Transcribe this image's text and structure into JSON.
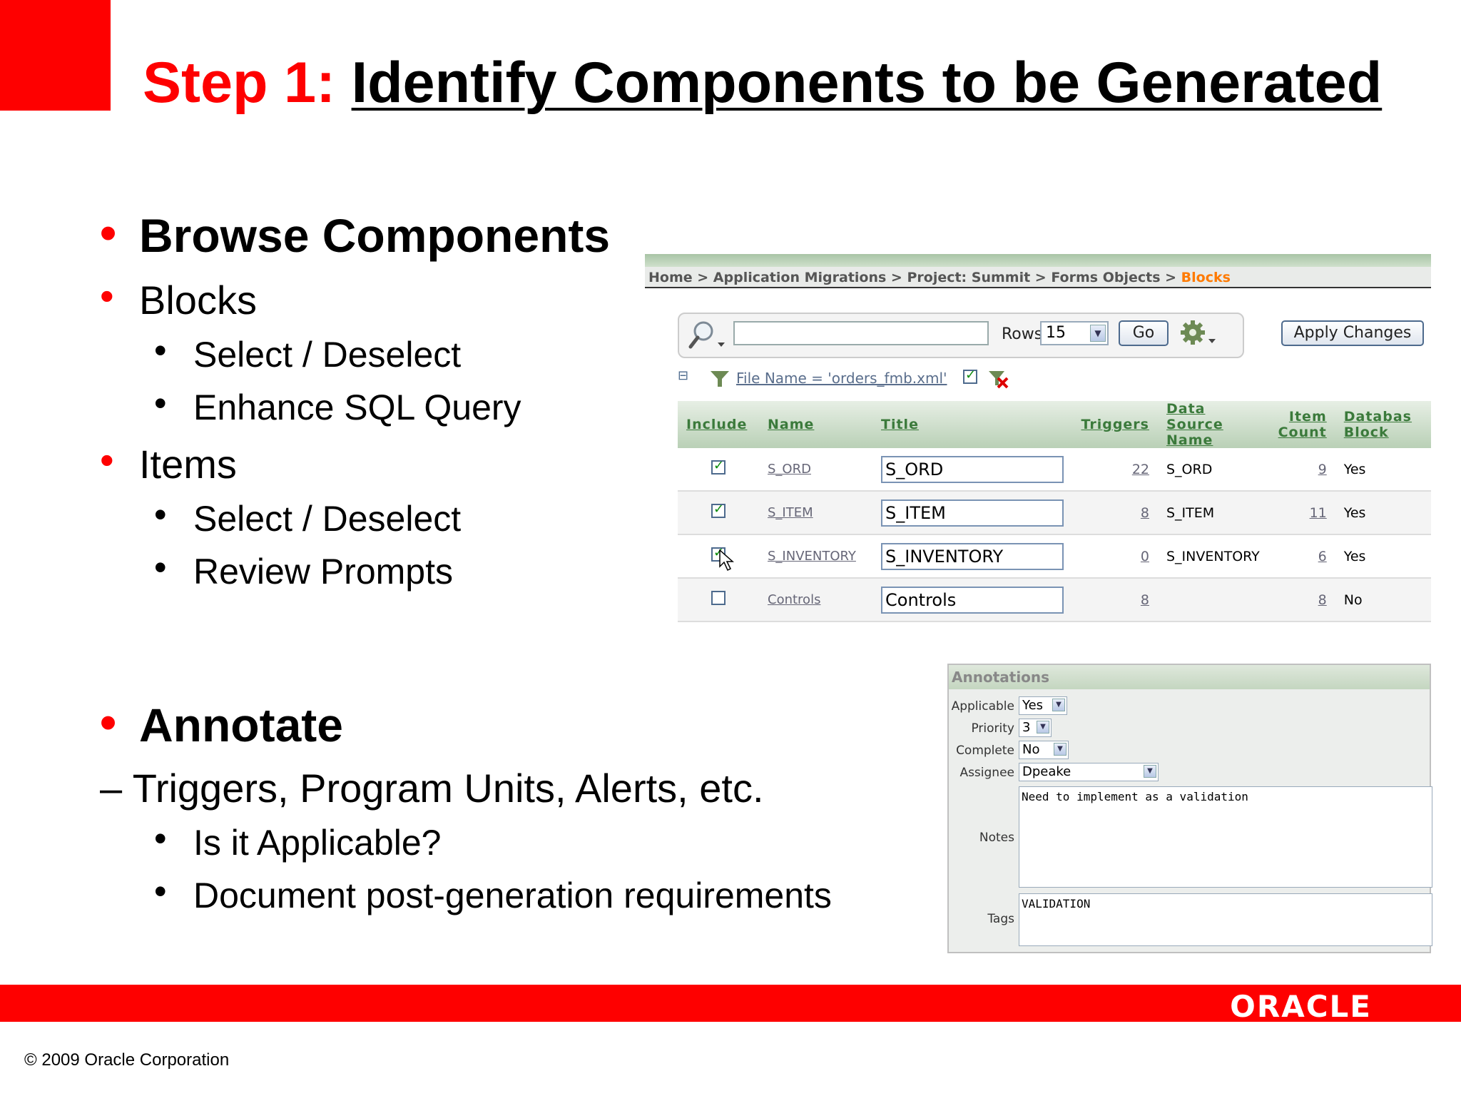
{
  "slide": {
    "title_step": "Step 1:",
    "title_main": "Identify Components to be Generated",
    "bullets": {
      "browse": "Browse Components",
      "blocks": "Blocks",
      "blocks_select": "Select / Deselect",
      "blocks_sql": "Enhance SQL Query",
      "items": "Items",
      "items_select": "Select / Deselect",
      "items_review": "Review Prompts",
      "annotate": "Annotate",
      "annotate_sub": "– Triggers, Program Units, Alerts, etc.",
      "applicable": "Is it Applicable?",
      "document": "Document post-generation requirements"
    },
    "brand": "ORACLE",
    "copyright": "© 2009 Oracle Corporation",
    "colors": {
      "brand_red": "#fe0000"
    }
  },
  "app": {
    "breadcrumb": {
      "home": "Home",
      "migrations": "Application Migrations",
      "project": "Project: Summit",
      "forms": "Forms Objects",
      "current": "Blocks",
      "sep": " > "
    },
    "search": {
      "value": "",
      "rows_label": "Rows",
      "rows_value": "15",
      "go_label": "Go",
      "icons": [
        "search-icon",
        "gear-icon"
      ]
    },
    "apply_label": "Apply Changes",
    "filter": {
      "text": "File Name = 'orders_fmb.xml'",
      "collapse": "⊟"
    },
    "table": {
      "headers": {
        "include": "Include",
        "name": "Name",
        "title": "Title",
        "triggers": "Triggers",
        "ds_1": "Data Source",
        "ds_2": "Name",
        "ic_1": "Item",
        "ic_2": "Count",
        "db_1": "Databas",
        "db_2": "Block"
      },
      "rows": [
        {
          "include": true,
          "name": "S_ORD",
          "title": "S_ORD",
          "triggers": "22",
          "data_source": "S_ORD",
          "item_count": "9",
          "db_block": "Yes"
        },
        {
          "include": true,
          "name": "S_ITEM",
          "title": "S_ITEM",
          "triggers": "8",
          "data_source": "S_ITEM",
          "item_count": "11",
          "db_block": "Yes"
        },
        {
          "include": true,
          "name": "S_INVENTORY",
          "title": "S_INVENTORY",
          "triggers": "0",
          "data_source": "S_INVENTORY",
          "item_count": "6",
          "db_block": "Yes"
        },
        {
          "include": false,
          "name": "Controls",
          "title": "Controls",
          "triggers": "8",
          "data_source": "",
          "item_count": "8",
          "db_block": "No"
        }
      ]
    },
    "annotations": {
      "heading": "Annotations",
      "applicable_label": "Applicable",
      "applicable_value": "Yes",
      "priority_label": "Priority",
      "priority_value": "3",
      "complete_label": "Complete",
      "complete_value": "No",
      "assignee_label": "Assignee",
      "assignee_value": "Dpeake",
      "notes_label": "Notes",
      "notes_value": "Need to implement as a validation",
      "tags_label": "Tags",
      "tags_value": "VALIDATION"
    }
  }
}
